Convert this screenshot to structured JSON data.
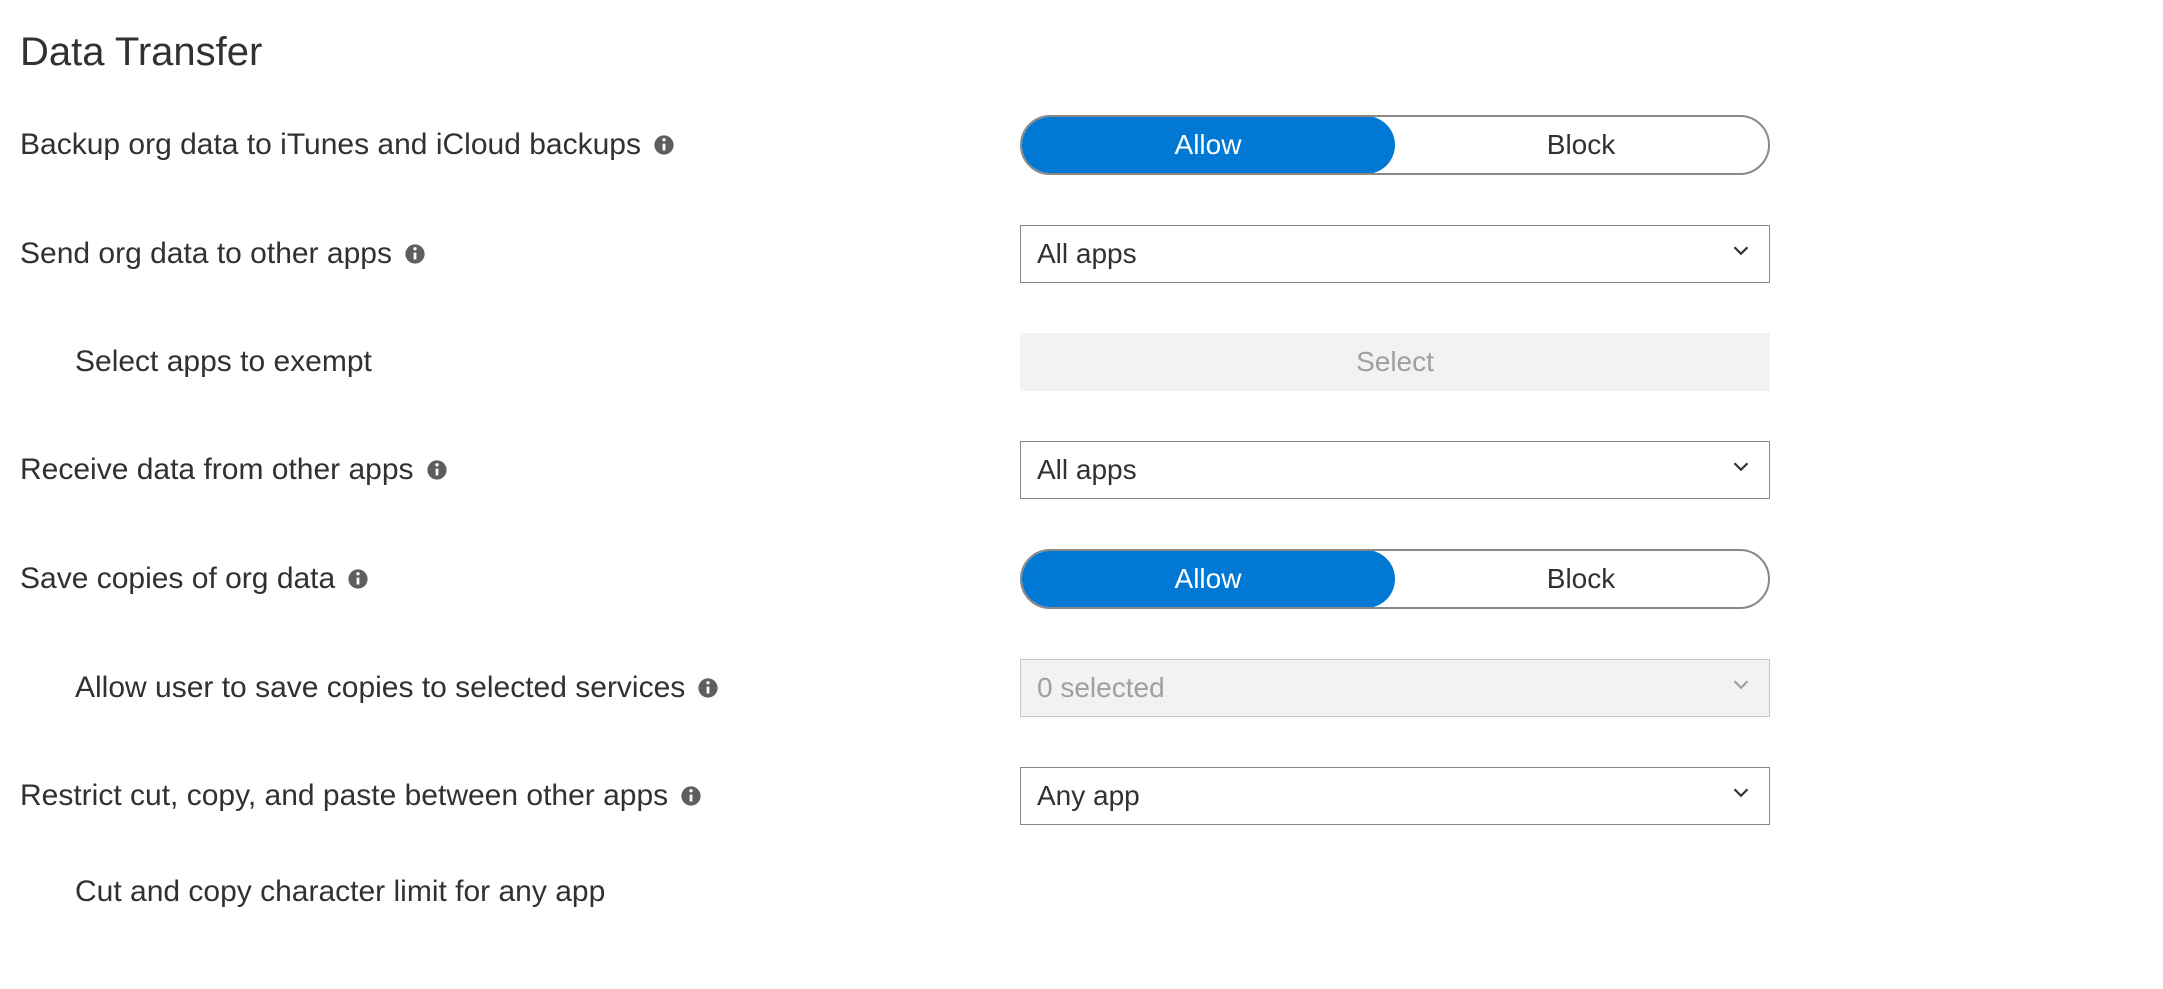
{
  "section": {
    "title": "Data Transfer"
  },
  "rows": {
    "backup": {
      "label": "Backup org data to iTunes and iCloud backups",
      "toggle": {
        "option1": "Allow",
        "option2": "Block",
        "selected": "Allow"
      }
    },
    "send": {
      "label": "Send org data to other apps",
      "value": "All apps"
    },
    "exempt": {
      "label": "Select apps to exempt",
      "button": "Select"
    },
    "receive": {
      "label": "Receive data from other apps",
      "value": "All apps"
    },
    "saveCopies": {
      "label": "Save copies of org data",
      "toggle": {
        "option1": "Allow",
        "option2": "Block",
        "selected": "Allow"
      }
    },
    "saveServices": {
      "label": "Allow user to save copies to selected services",
      "value": "0 selected"
    },
    "restrictCutCopy": {
      "label": "Restrict cut, copy, and paste between other apps",
      "value": "Any app"
    },
    "charLimit": {
      "label": "Cut and copy character limit for any app"
    }
  }
}
